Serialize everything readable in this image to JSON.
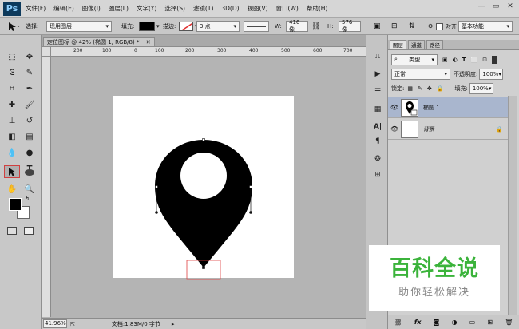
{
  "app": {
    "logo": "Ps"
  },
  "menu": [
    "文件(F)",
    "编辑(E)",
    "图像(I)",
    "图层(L)",
    "文字(Y)",
    "选择(S)",
    "滤镜(T)",
    "3D(D)",
    "视图(V)",
    "窗口(W)",
    "帮助(H)"
  ],
  "window_controls": {
    "minimize": "—",
    "restore": "▭",
    "close": "✕"
  },
  "options": {
    "select_label": "选择:",
    "select_value": "现用图层",
    "fill_label": "填充:",
    "stroke_label": "描边:",
    "stroke_size": "3 点",
    "w_label": "W:",
    "w_value": "416 像",
    "h_label": "H:",
    "h_value": "576 像",
    "align_edges_label": "对齐",
    "workspace": "基本功能"
  },
  "document": {
    "tab_title": "定位图标 @ 42% (椭圆 1, RGB/8) *",
    "ruler_ticks": [
      "200",
      "100",
      "0",
      "100",
      "200",
      "300",
      "400",
      "500",
      "600",
      "700"
    ],
    "zoom": "41.96%",
    "doc_info": "文档:1.83M/0 字节"
  },
  "panel": {
    "tabs": [
      "图层",
      "通道",
      "路径"
    ],
    "kind_filter": "类型",
    "blend_mode": "正常",
    "opacity_label": "不透明度:",
    "opacity_value": "100%",
    "lock_label": "锁定:",
    "fill_label": "填充:",
    "fill_value": "100%",
    "layers": [
      {
        "name": "椭圆 1",
        "selected": true
      },
      {
        "name": "背景",
        "selected": false
      }
    ]
  },
  "watermark": {
    "title": "百科全说",
    "subtitle": "助你轻松解决"
  },
  "colors": {
    "accent_green": "#3bb33b",
    "selection_red": "#e04040",
    "layer_selected": "#a9b6ce"
  }
}
